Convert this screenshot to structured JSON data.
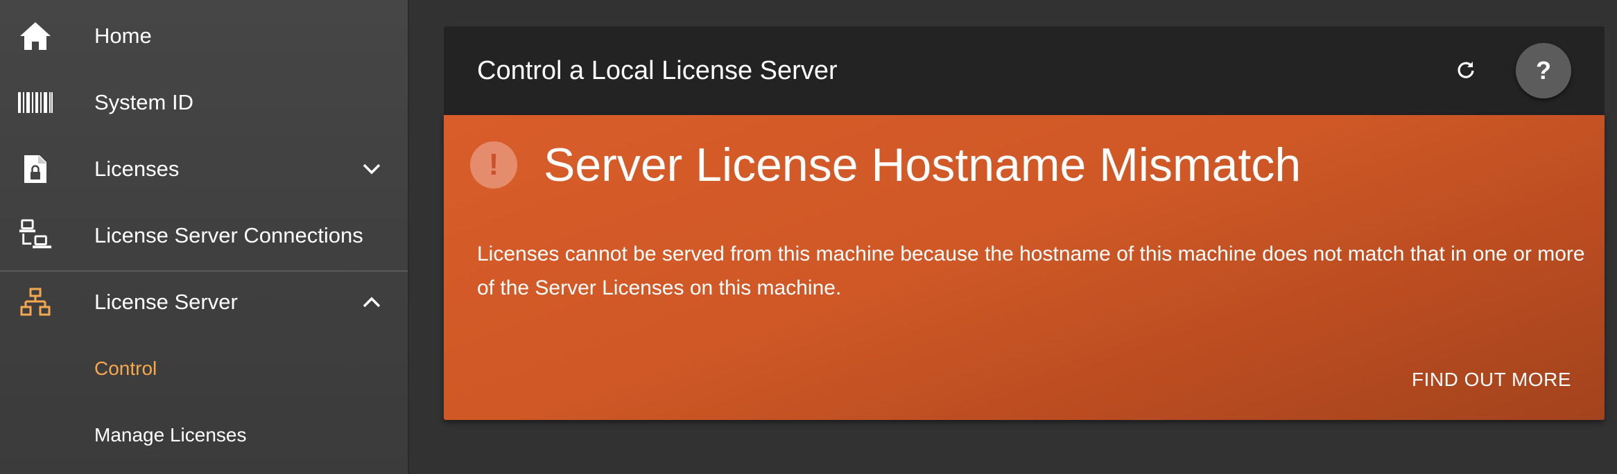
{
  "sidebar": {
    "items": [
      {
        "label": "Home",
        "icon": "home-icon"
      },
      {
        "label": "System ID",
        "icon": "barcode-icon"
      },
      {
        "label": "Licenses",
        "icon": "license-file-icon"
      },
      {
        "label": "License Server Connections",
        "icon": "connections-icon"
      },
      {
        "label": "License Server",
        "icon": "network-icon"
      }
    ],
    "sub_items": [
      {
        "label": "Control",
        "active": true
      },
      {
        "label": "Manage Licenses",
        "active": false
      }
    ],
    "active_color": "#f5a84e"
  },
  "card": {
    "title": "Control a Local License Server",
    "refresh_icon": "refresh-icon",
    "help_label": "?"
  },
  "alert": {
    "icon_glyph": "!",
    "title": "Server License Hostname Mismatch",
    "body": "Licenses cannot be served from this machine because the hostname of this machine does not match that in one or more of the Server Licenses on this machine.",
    "action_label": "FIND OUT MORE",
    "color": "#cf5826"
  }
}
